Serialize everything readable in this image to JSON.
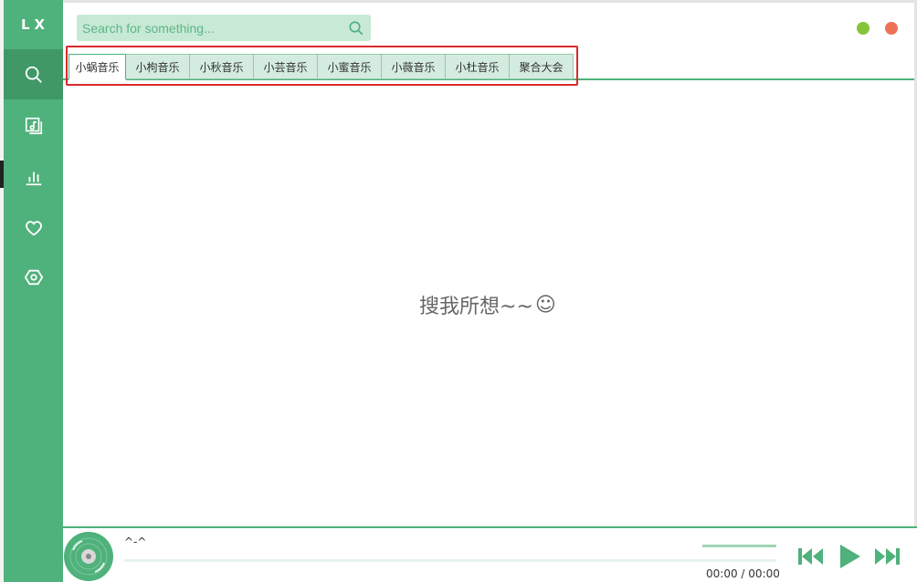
{
  "app": {
    "logo": "LX"
  },
  "sidebar": {
    "items": [
      {
        "name": "search",
        "icon": "search-icon",
        "active": true
      },
      {
        "name": "song-list",
        "icon": "music-list-icon",
        "active": false
      },
      {
        "name": "leaderboard",
        "icon": "bar-chart-icon",
        "active": false
      },
      {
        "name": "favorites",
        "icon": "heart-icon",
        "active": false
      },
      {
        "name": "settings",
        "icon": "settings-icon",
        "active": false
      }
    ]
  },
  "search": {
    "placeholder": "Search for something..."
  },
  "window": {
    "minimize_color": "#85c43b",
    "close_color": "#ee7257"
  },
  "tabs": [
    {
      "label": "小蜗音乐",
      "active": true
    },
    {
      "label": "小枸音乐",
      "active": false
    },
    {
      "label": "小秋音乐",
      "active": false
    },
    {
      "label": "小芸音乐",
      "active": false
    },
    {
      "label": "小蜜音乐",
      "active": false
    },
    {
      "label": "小薇音乐",
      "active": false
    },
    {
      "label": "小杜音乐",
      "active": false
    },
    {
      "label": "聚合大会",
      "active": false
    }
  ],
  "main": {
    "empty_hint": "搜我所想~~",
    "empty_hint_emoji": "☺"
  },
  "player": {
    "title": "^-^",
    "time_current": "00:00",
    "time_separator": "/",
    "time_total": "00:00",
    "progress": 0
  },
  "colors": {
    "accent": "#4fb17b",
    "accent_dark": "#3f9866",
    "highlight_box": "#d9292b"
  }
}
